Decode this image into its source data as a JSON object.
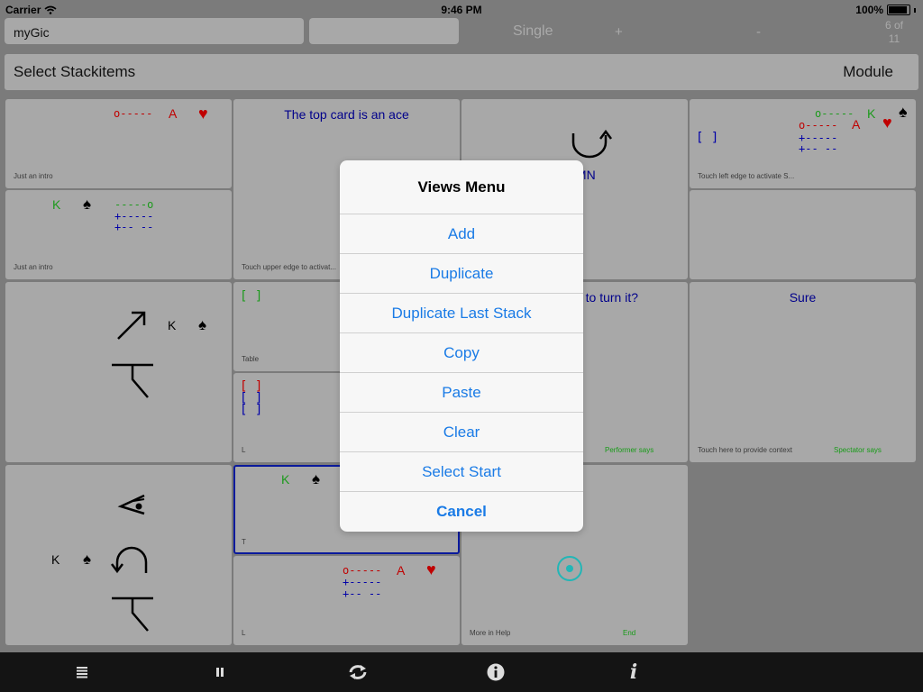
{
  "status": {
    "carrier": "Carrier",
    "time": "9:46 PM",
    "battery": "100%"
  },
  "top": {
    "name_value": "myGic",
    "mode": "Single",
    "plus": "+",
    "minus": "-",
    "page": "6 of\n11"
  },
  "header": {
    "title": "Select Stackitems",
    "module": "Module"
  },
  "cards": {
    "c1_cap": "Just an intro",
    "c1_o": "o-----",
    "c1_a": "A",
    "c1_heart": "♥",
    "c2_text": "The top card is an ace",
    "c2_cap": "Touch upper edge to activat...",
    "c3_text": "ALTMN",
    "c4_o1": "o-----",
    "c4_k": "K",
    "c4_spade": "♠",
    "c4_o2": "o-----",
    "c4_a": "A",
    "c4_heart": "♥",
    "c4_p1": "+-----",
    "c4_p2": "+-- --",
    "c4_br": "[ ]",
    "c4_cap": "Touch left edge to activate S...",
    "c5_k": "K",
    "c5_spade": "♠",
    "c5_l1": "-----o",
    "c5_l2": "+-----",
    "c5_l3": "+-- --",
    "c5_cap": "Just an intro",
    "c7_k": "K",
    "c7_spade": "♠",
    "c8_br": "[ ]",
    "c8_cap": "Table",
    "c9_text": "Would you like to turn it?",
    "c9_cap": "Performer says",
    "c10_text": "Sure",
    "c10_cap": "Touch here to provide context",
    "c10_cap2": "Spectator says",
    "c11_br1": "[ ]",
    "c11_br2": "[ ]",
    "c11_br3": "[ ]",
    "c11_cap": "L",
    "c12_k": "K",
    "c12_spade": "♠",
    "c13_k": "K",
    "c13_spade": "♠",
    "c13_cap": "T",
    "c14_o": "o-----",
    "c14_a": "A",
    "c14_heart": "♥",
    "c14_p1": "+-----",
    "c14_p2": "+-- --",
    "c14_cap": "L",
    "c15_cap": "More in Help",
    "c15_cap2": "End"
  },
  "menu": {
    "title": "Views Menu",
    "items": [
      "Add",
      "Duplicate",
      "Duplicate Last Stack",
      "Copy",
      "Paste",
      "Clear",
      "Select Start"
    ],
    "cancel": "Cancel"
  },
  "toolbar": {
    "icons": [
      "list-icon",
      "pause-icon",
      "refresh-icon",
      "info-circle-icon",
      "info-italic-icon"
    ]
  }
}
